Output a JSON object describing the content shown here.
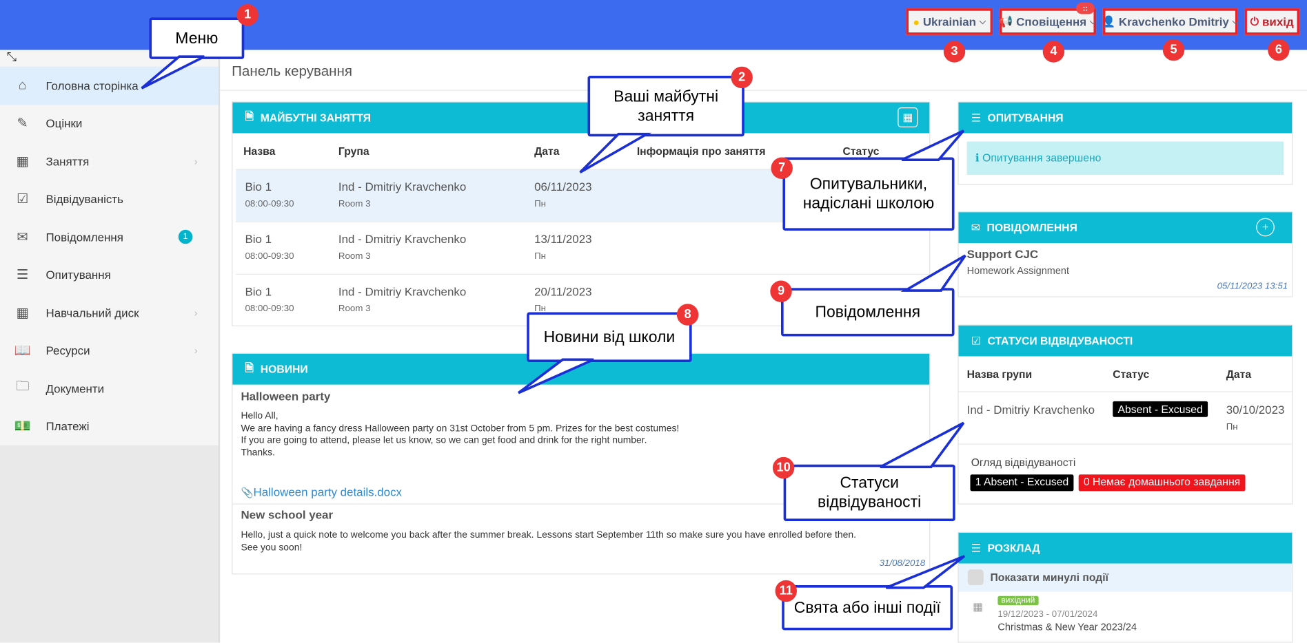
{
  "topbar": {
    "language": "Ukrainian",
    "notifications": "Сповіщення",
    "notif_badge": "::",
    "user": "Kravchenko Dmitriy",
    "logout": "вихід"
  },
  "sidebar": {
    "items": [
      {
        "label": "Головна сторінка",
        "icon": "home-icon"
      },
      {
        "label": "Оцінки",
        "icon": "grades-icon"
      },
      {
        "label": "Заняття",
        "icon": "calendar-icon"
      },
      {
        "label": "Відвідуваність",
        "icon": "checkbox-icon"
      },
      {
        "label": "Повідомлення",
        "icon": "envelope-icon",
        "badge": "1"
      },
      {
        "label": "Опитування",
        "icon": "survey-icon"
      },
      {
        "label": "Навчальний диск",
        "icon": "calendar-icon"
      },
      {
        "label": "Ресурси",
        "icon": "book-icon"
      },
      {
        "label": "Документи",
        "icon": "folder-icon"
      },
      {
        "label": "Платежі",
        "icon": "money-icon"
      }
    ]
  },
  "page_title": "Панель керування",
  "lessons": {
    "title": "МАЙБУТНІ ЗАНЯТТЯ",
    "columns": [
      "Назва",
      "Група",
      "Дата",
      "Інформація про заняття",
      "Статус"
    ],
    "rows": [
      {
        "name": "Bio 1",
        "time": "08:00-09:30",
        "group": "Ind - Dmitriy Kravchenko",
        "room": "Room 3",
        "date": "06/11/2023",
        "day": "Пн"
      },
      {
        "name": "Bio 1",
        "time": "08:00-09:30",
        "group": "Ind - Dmitriy Kravchenko",
        "room": "Room 3",
        "date": "13/11/2023",
        "day": "Пн"
      },
      {
        "name": "Bio 1",
        "time": "08:00-09:30",
        "group": "Ind - Dmitriy Kravchenko",
        "room": "Room 3",
        "date": "20/11/2023",
        "day": "Пн"
      }
    ]
  },
  "news": {
    "title": "НОВИНИ",
    "items": [
      {
        "title": "Halloween party",
        "body": "Hello All,\nWe are having a fancy dress Halloween party on 31st October from 5 pm. Prizes for the best costumes!\nIf you are going to attend, please let us know, so we can get food and drink for the right number.\nThanks.",
        "attachment": "Halloween party details.docx"
      },
      {
        "title": "New school year",
        "body": "Hello, just a quick note to welcome you back after the summer break. Lessons start September 11th so make sure you have enrolled before then.\nSee you soon!",
        "date": "31/08/2018"
      }
    ]
  },
  "surveys": {
    "title": "ОПИТУВАННЯ",
    "alert": "Опитування завершено"
  },
  "messages": {
    "title": "ПОВІДОМЛЕННЯ",
    "sender": "Support CJC",
    "subject": "Homework Assignment",
    "date": "05/11/2023 13:51"
  },
  "attendance": {
    "title": "СТАТУСИ ВІДВІДУВАНОСТІ",
    "columns": [
      "Назва групи",
      "Статус",
      "Дата"
    ],
    "row": {
      "group": "Ind - Dmitriy Kravchenko",
      "status": "Absent - Excused",
      "date": "30/10/2023",
      "day": "Пн"
    },
    "overview_label": "Огляд відвідуваності",
    "overview": [
      "1 Absent - Excused",
      "0 Немає домашнього завдання"
    ]
  },
  "schedule": {
    "title": "РОЗКЛАД",
    "show_past": "Показати минулі події",
    "event": {
      "tag": "вихідний",
      "dates": "19/12/2023 - 07/01/2024",
      "name": "Christmas & New Year 2023/24"
    }
  },
  "callouts": [
    {
      "num": "1",
      "text": "Меню"
    },
    {
      "num": "2",
      "text": "Ваші майбутні заняття"
    },
    {
      "num": "3"
    },
    {
      "num": "4"
    },
    {
      "num": "5"
    },
    {
      "num": "6"
    },
    {
      "num": "7",
      "text": "Опитувальники, надіслані школою"
    },
    {
      "num": "8",
      "text": "Новини від школи"
    },
    {
      "num": "9",
      "text": "Повідомлення"
    },
    {
      "num": "10",
      "text": "Статуси відвідуваності"
    },
    {
      "num": "11",
      "text": "Свята або інші події"
    }
  ],
  "colors": {
    "topbar": "#3c6bf0",
    "panel_header": "#0dbcd4",
    "callout_border": "#1b2fd6",
    "marker": "#ee3434"
  }
}
